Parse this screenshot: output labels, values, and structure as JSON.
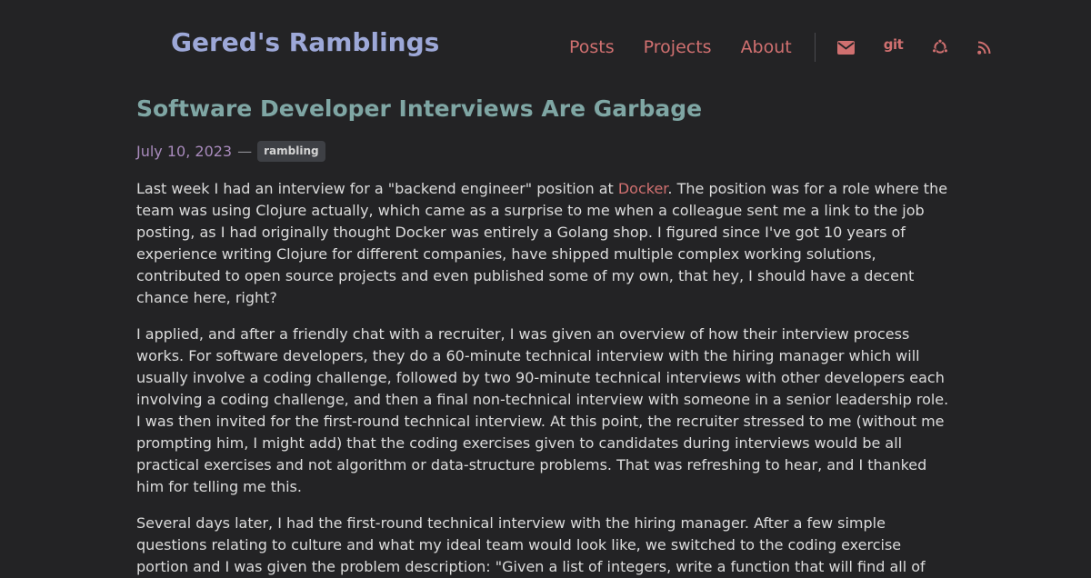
{
  "site": {
    "title": "Gered's Ramblings"
  },
  "nav": {
    "posts": "Posts",
    "projects": "Projects",
    "about": "About",
    "git_label": "git"
  },
  "colors": {
    "background": "#232325",
    "site_title": "#9da8d8",
    "accent": "#d07070",
    "post_title": "#7fa6a4",
    "date": "#a88abc"
  },
  "icons": [
    "envelope-icon",
    "git-icon",
    "ubuntu-icon",
    "rss-icon"
  ],
  "post": {
    "title": "Software Developer Interviews Are Garbage",
    "date": "July 10, 2023",
    "separator": "—",
    "tag": "rambling",
    "p1_before": "Last week I had an interview for a \"backend engineer\" position at ",
    "p1_link": "Docker",
    "p1_after": ". The position was for a role where the team was using Clojure actually, which came as a surprise to me when a colleague sent me a link to the job posting, as I had originally thought Docker was entirely a Golang shop. I figured since I've got 10 years of experience writing Clojure for different companies, have shipped multiple complex working solutions, contributed to open source projects and even published some of my own, that hey, I should have a decent chance here, right?",
    "p2": "I applied, and after a friendly chat with a recruiter, I was given an overview of how their interview process works. For software developers, they do a 60-minute technical interview with the hiring manager which will usually involve a coding challenge, followed by two 90-minute technical interviews with other developers each involving a coding challenge, and then a final non-technical interview with someone in a senior leadership role. I was then invited for the first-round technical interview. At this point, the recruiter stressed to me (without me prompting him, I might add) that the coding exercises given to candidates during interviews would be all practical exercises and not algorithm or data-structure problems. That was refreshing to hear, and I thanked him for telling me this.",
    "p3": "Several days later, I had the first-round technical interview with the hiring manager. After a few simple questions relating to culture and what my ideal team would look like, we switched to the coding exercise portion and I was given the problem description: \"Given a list of integers, write a function that will find all of"
  }
}
